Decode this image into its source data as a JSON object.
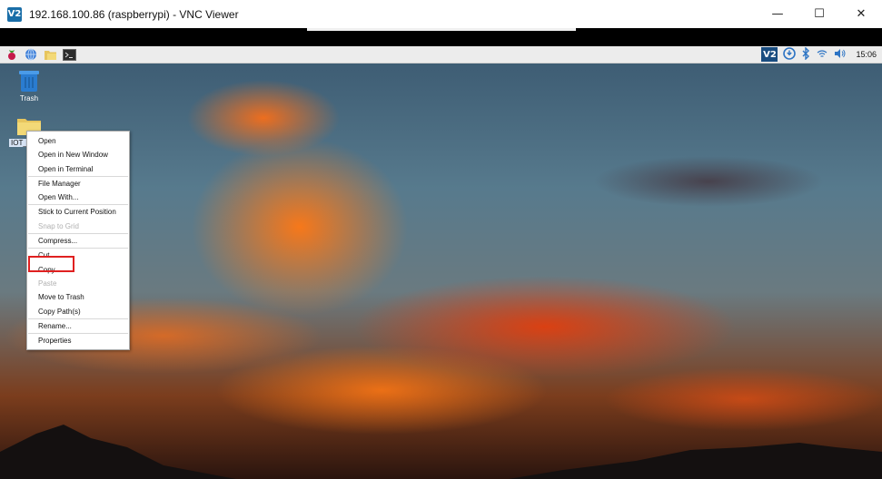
{
  "window": {
    "app_icon_text": "V2",
    "title": "192.168.100.86 (raspberrypi) - VNC Viewer",
    "minimize": "—",
    "maximize": "☐",
    "close": "✕"
  },
  "taskbar": {
    "launchers": [
      "raspberry-menu-icon",
      "web-browser-icon",
      "file-manager-icon",
      "terminal-icon"
    ],
    "tray": {
      "vnc_icon_text": "V2",
      "clock": "15:06"
    }
  },
  "desktop": {
    "icons": [
      {
        "label": "Trash",
        "icon": "trash-icon"
      },
      {
        "label": "IOT_",
        "icon": "folder-icon"
      }
    ]
  },
  "context_menu": {
    "items": [
      {
        "label": "Open",
        "disabled": false
      },
      {
        "label": "Open in New Window",
        "disabled": false
      },
      {
        "label": "Open in Terminal",
        "disabled": false
      },
      {
        "label": "File Manager",
        "disabled": false
      },
      {
        "label": "Open With...",
        "disabled": false
      },
      {
        "label": "Stick to Current Position",
        "disabled": false
      },
      {
        "label": "Snap to Grid",
        "disabled": true
      },
      {
        "label": "Compress...",
        "disabled": false
      },
      {
        "label": "Cut",
        "disabled": false
      },
      {
        "label": "Copy",
        "disabled": false
      },
      {
        "label": "Paste",
        "disabled": true
      },
      {
        "label": "Move to Trash",
        "disabled": false
      },
      {
        "label": "Copy Path(s)",
        "disabled": false
      },
      {
        "label": "Rename...",
        "disabled": false
      },
      {
        "label": "Properties",
        "disabled": false
      }
    ],
    "highlighted": "Copy",
    "highlight_color": "#e02020"
  }
}
